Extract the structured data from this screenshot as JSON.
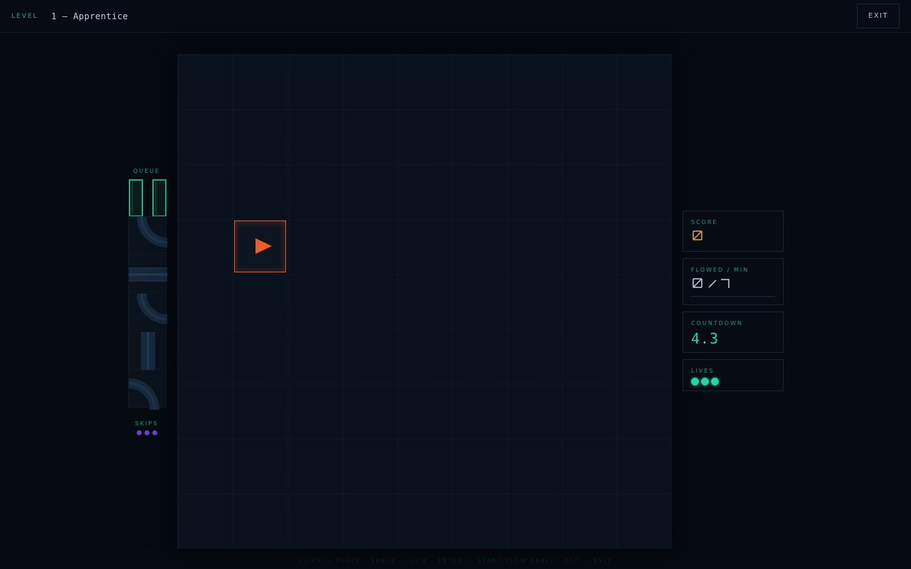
{
  "header": {
    "level_label": "LEVEL",
    "level_name": "1 — Apprentice",
    "exit_label": "EXIT"
  },
  "queue": {
    "title": "QUEUE",
    "pieces": [
      "cross-vertical",
      "curve-bottom-left",
      "straight-horizontal",
      "curve-bottom-left",
      "straight-vertical",
      "curve-top-right"
    ]
  },
  "skips": {
    "title": "SKIPS",
    "remaining": 3
  },
  "stats": {
    "score_title": "SCORE",
    "score_value": "0",
    "flowed_title": "FLOWED / MIN",
    "flowed_value": "0",
    "min_value": "7",
    "flowed_progress": 0,
    "countdown_title": "COUNTDOWN",
    "countdown_value": "4.3",
    "lives_title": "LIVES",
    "lives": 3
  },
  "board": {
    "rows": 9,
    "cols": 9,
    "source_direction": "right"
  },
  "hint": "CLICK — PLACE · SPACE — SKIP · ENTER — START FLOW EARLY · ESC — EXIT",
  "colors": {
    "accent": "#22d6a6",
    "source": "#e8532a",
    "score": "#f0a830",
    "skip": "#6c3fd1",
    "background": "#060a11"
  }
}
